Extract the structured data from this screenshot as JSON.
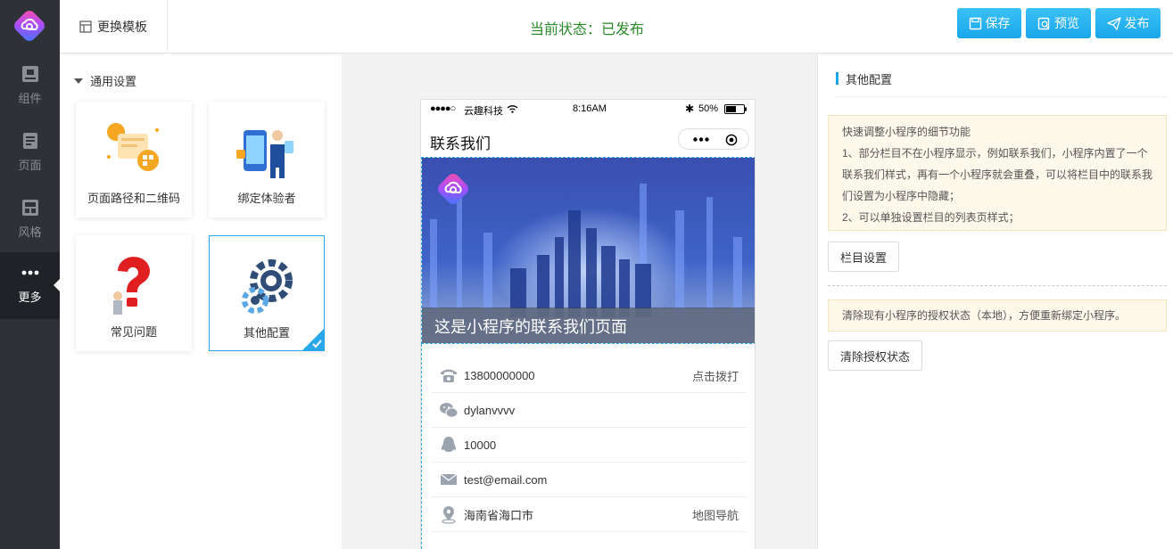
{
  "nav": {
    "items": [
      {
        "label": "组件",
        "icon": "component-icon"
      },
      {
        "label": "页面",
        "icon": "page-icon"
      },
      {
        "label": "风格",
        "icon": "style-icon"
      },
      {
        "label": "更多",
        "icon": "more-icon"
      }
    ],
    "active": "更多"
  },
  "topbar": {
    "template_button": "更换模板",
    "status": "当前状态：已发布",
    "save": "保存",
    "preview": "预览",
    "publish": "发布"
  },
  "settings": {
    "section_title": "通用设置",
    "cards": [
      {
        "label": "页面路径和二维码"
      },
      {
        "label": "绑定体验者"
      },
      {
        "label": "常见问题"
      },
      {
        "label": "其他配置",
        "selected": true
      }
    ]
  },
  "phone": {
    "carrier": "云趣科技",
    "time": "8:16AM",
    "battery": "50%",
    "page_title": "联系我们",
    "banner_caption": "这是小程序的联系我们页面",
    "rows": [
      {
        "icon": "phone-icon",
        "value": "13800000000",
        "action": "点击拨打"
      },
      {
        "icon": "wechat-icon",
        "value": "dylanvvvv",
        "action": ""
      },
      {
        "icon": "qq-icon",
        "value": "10000",
        "action": ""
      },
      {
        "icon": "mail-icon",
        "value": "test@email.com",
        "action": ""
      },
      {
        "icon": "location-icon",
        "value": "海南省海口市",
        "action": "地图导航"
      }
    ]
  },
  "rpanel": {
    "title": "其他配置",
    "notice1": [
      "快速调整小程序的细节功能",
      "1、部分栏目不在小程序显示，例如联系我们，小程序内置了一个联系我们样式，再有一个小程序就会重叠，可以将栏目中的联系我们设置为小程序中隐藏；",
      "2、可以单独设置栏目的列表页样式；"
    ],
    "column_button": "栏目设置",
    "notice2": "清除现有小程序的授权状态（本地），方便重新绑定小程序。",
    "clear_button": "清除授权状态"
  },
  "colors": {
    "accent": "#1aa7ea",
    "status_green": "#2a8a2a",
    "nav_bg": "#2e3136"
  }
}
